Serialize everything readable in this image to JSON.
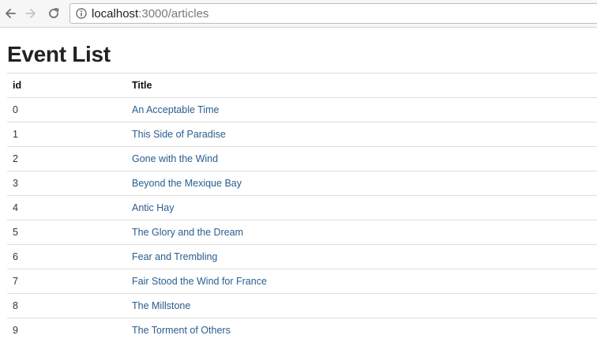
{
  "browser": {
    "url_host": "localhost",
    "url_path": ":3000/articles"
  },
  "page": {
    "heading": "Event List",
    "columns": [
      "id",
      "Title"
    ],
    "rows": [
      {
        "id": "0",
        "title": "An Acceptable Time"
      },
      {
        "id": "1",
        "title": "This Side of Paradise"
      },
      {
        "id": "2",
        "title": "Gone with the Wind"
      },
      {
        "id": "3",
        "title": "Beyond the Mexique Bay"
      },
      {
        "id": "4",
        "title": "Antic Hay"
      },
      {
        "id": "5",
        "title": "The Glory and the Dream"
      },
      {
        "id": "6",
        "title": "Fear and Trembling"
      },
      {
        "id": "7",
        "title": "Fair Stood the Wind for France"
      },
      {
        "id": "8",
        "title": "The Millstone"
      },
      {
        "id": "9",
        "title": "The Torment of Others"
      }
    ]
  },
  "icons": {
    "back": "arrow-left-icon",
    "forward": "arrow-right-icon",
    "reload": "reload-icon",
    "info": "info-icon"
  },
  "colors": {
    "link": "#2a5d8f",
    "toolbar": "#f6f6f6"
  }
}
